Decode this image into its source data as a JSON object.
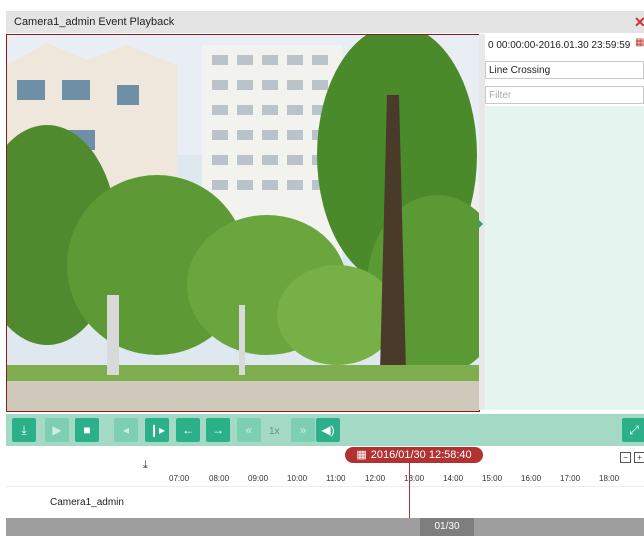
{
  "window": {
    "title": "Camera1_admin Event Playback",
    "close_glyph": "✕"
  },
  "right_panel": {
    "time_range": "0 00:00:00-2016.01.30 23:59:59",
    "event_type": "Line Crossing",
    "filter_placeholder": "Filter"
  },
  "toolbar": {
    "speed_label": "1x",
    "icons": [
      "download-icon",
      "play-icon",
      "stop-icon",
      "reverse-frame-icon",
      "next-frame-icon",
      "rewind-icon",
      "forward-icon",
      "slow-icon",
      "fast-icon",
      "audio-icon",
      "fullscreen-icon"
    ]
  },
  "timeline": {
    "current_datetime": "2016/01/30 12:58:40",
    "ticks": [
      "07:00",
      "08:00",
      "09:00",
      "10:00",
      "11:00",
      "12:00",
      "13:00",
      "14:00",
      "15:00",
      "16:00",
      "17:00",
      "18:00"
    ],
    "zoom_out": "−",
    "zoom_in": "+"
  },
  "tracks": [
    {
      "label": "Camera1_admin"
    }
  ],
  "pager": {
    "label": "01/30"
  },
  "colors": {
    "accent": "#2cb08a",
    "toolbar_bg": "#a4d9c6",
    "highlight_red": "#b23232",
    "list_bg": "#e6f5ef"
  }
}
